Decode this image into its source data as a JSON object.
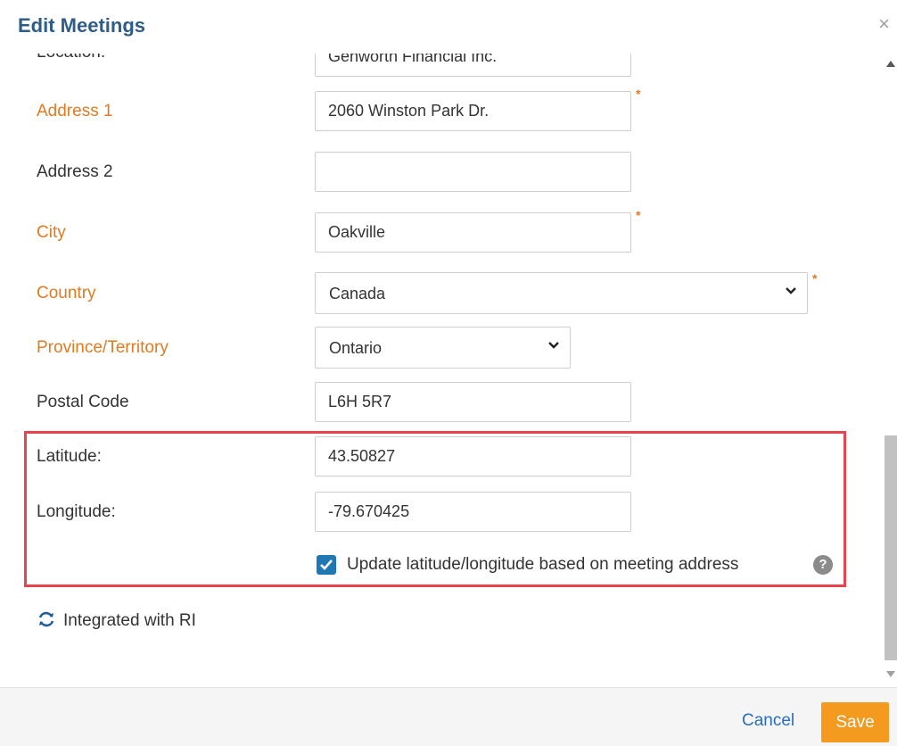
{
  "header": {
    "title": "Edit Meetings",
    "close_glyph": "×"
  },
  "form": {
    "location": {
      "label": "Location:",
      "value": "Genworth Financial Inc."
    },
    "address1": {
      "label": "Address 1",
      "value": "2060 Winston Park Dr.",
      "required_mark": "*"
    },
    "address2": {
      "label": "Address 2",
      "value": ""
    },
    "city": {
      "label": "City",
      "value": "Oakville",
      "required_mark": "*"
    },
    "country": {
      "label": "Country",
      "selected": "Canada",
      "required_mark": "*"
    },
    "province": {
      "label": "Province/Territory",
      "selected": "Ontario"
    },
    "postal_code": {
      "label": "Postal Code",
      "value": "L6H 5R7"
    },
    "latitude": {
      "label": "Latitude:",
      "value": "43.50827"
    },
    "longitude": {
      "label": "Longitude:",
      "value": "-79.670425"
    },
    "update_geo": {
      "label": "Update latitude/longitude based on meeting address",
      "checked": true,
      "help_glyph": "?"
    }
  },
  "integration": {
    "label": "Integrated with RI",
    "icon": "sync-icon"
  },
  "footer": {
    "cancel_label": "Cancel",
    "save_label": "Save"
  },
  "colors": {
    "title": "#2e5d87",
    "required_label": "#e07b22",
    "highlight_border": "#e8444f",
    "checkbox": "#1f78b4",
    "save_button": "#f39a1f",
    "cancel_link": "#2a6ebb"
  }
}
